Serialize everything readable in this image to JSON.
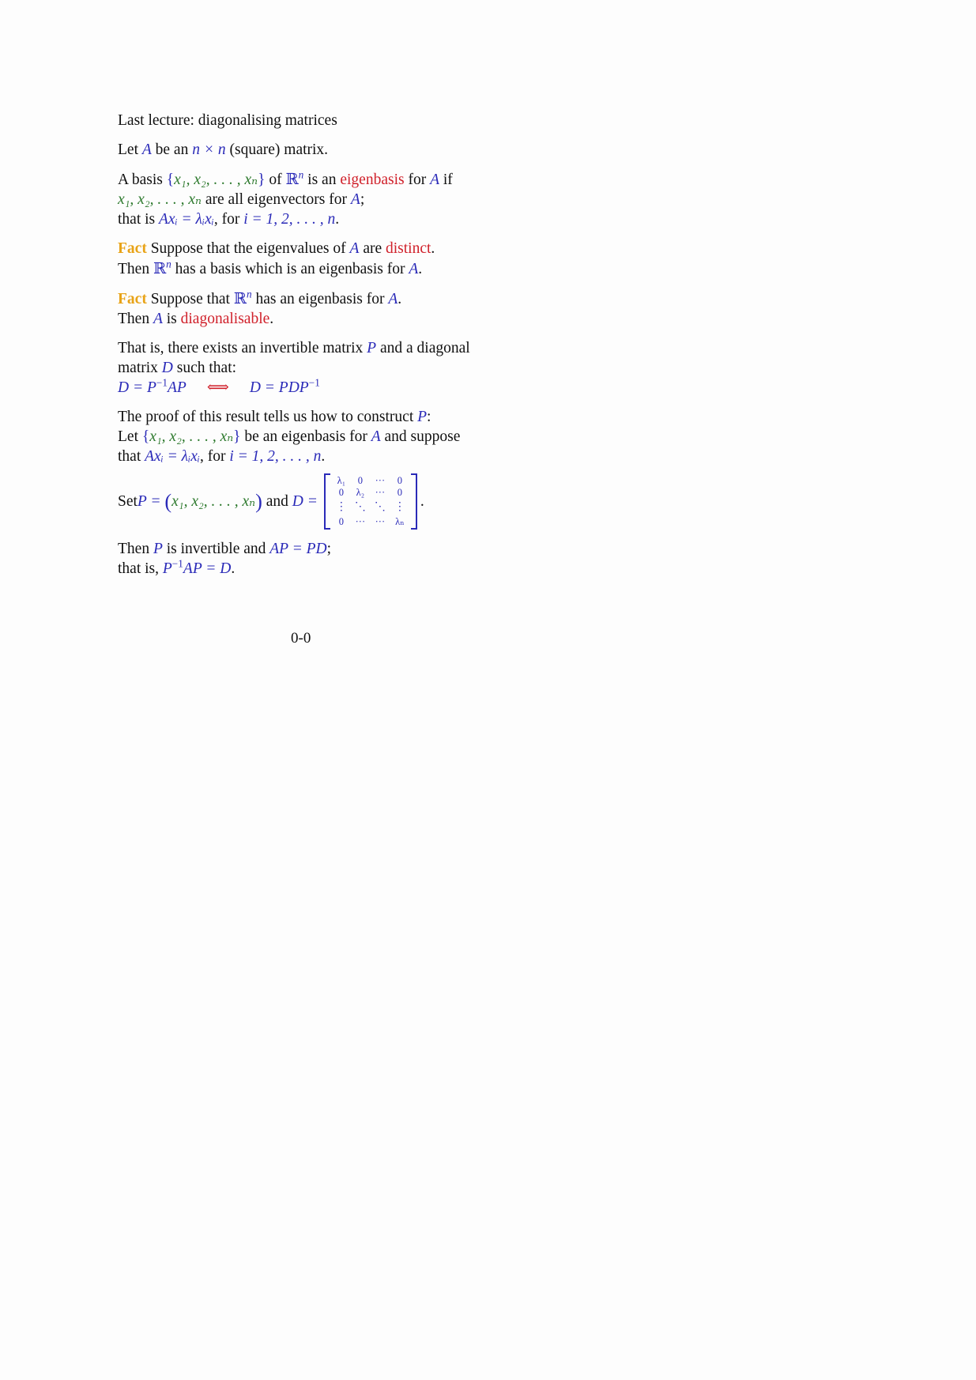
{
  "title": "Last lecture: diagonalising matrices",
  "intro": {
    "pre": "Let ",
    "A": "A",
    "mid": " be an ",
    "nxn": "n × n",
    "post": " (square) matrix."
  },
  "basis_def": {
    "line1_pre": "A basis ",
    "set": "x₁, x₂, . . . , xₙ",
    "of": " of ",
    "Rn": "ℝ",
    "n": "n",
    "is_an": " is an ",
    "eigenbasis": "eigenbasis",
    "for": " for ",
    "A": "A",
    "if": " if",
    "line2_vecs": "x₁, x₂, . . . , xₙ",
    "line2_post": " are all eigenvectors for ",
    "line2_end": ";",
    "line3_pre": "that is ",
    "line3_eq": "Axᵢ = λᵢxᵢ",
    "line3_mid": ", for ",
    "line3_range": "i = 1, 2, . . . , n",
    "line3_end": "."
  },
  "fact1": {
    "label": "Fact",
    "line1_pre": " Suppose that the eigenvalues of ",
    "A": "A",
    "line1_mid": " are ",
    "distinct": "distinct",
    "line1_end": ".",
    "line2_pre": "Then ",
    "Rn": "ℝ",
    "n": "n",
    "line2_post": " has a basis which is an eigenbasis for ",
    "line2_end": "."
  },
  "fact2": {
    "label": "Fact",
    "line1_pre": " Suppose that ",
    "Rn": "ℝ",
    "n": "n",
    "line1_post": " has an eigenbasis for ",
    "A": "A",
    "line1_end": ".",
    "line2_pre": "Then ",
    "line2_mid": " is ",
    "diagonalisable": "diagonalisable",
    "line2_end": "."
  },
  "exists": {
    "line1_pre": "That is, there exists an invertible matrix ",
    "P": "P",
    "line1_post": " and a diagonal",
    "line2_pre": "matrix ",
    "D": "D",
    "line2_post": " such that:",
    "eq_left": "D = P",
    "eq_left_sup": "−1",
    "eq_left_post": "AP",
    "iff": "⟺",
    "eq_right": "D = PDP",
    "eq_right_sup": "−1"
  },
  "proof": {
    "line1_pre": "The proof of this result tells us how to construct ",
    "P": "P",
    "line1_end": ":",
    "line2_pre": "Let ",
    "set": "x₁, x₂, . . . , xₙ",
    "line2_mid": " be an eigenbasis for ",
    "A": "A",
    "line2_post": " and suppose",
    "line3_pre": "that ",
    "line3_eq": "Axᵢ = λᵢxᵢ",
    "line3_mid": ", for ",
    "line3_range": "i = 1, 2, . . . , n",
    "line3_end": "."
  },
  "setline": {
    "pre": "Set ",
    "P_eq": "P = ",
    "vecs": "x₁, x₂, . . . , xₙ",
    "and": " and ",
    "D_eq": "D =",
    "end": ".",
    "matrix": [
      [
        "λ₁",
        "0",
        "···",
        "0"
      ],
      [
        "0",
        "λ₂",
        "···",
        "0"
      ],
      [
        "⋮",
        "⋱",
        "⋱",
        "⋮"
      ],
      [
        "0",
        "···",
        "···",
        "λₙ"
      ]
    ]
  },
  "conclusion": {
    "line1_pre": "Then ",
    "P": "P",
    "line1_mid": " is invertible and ",
    "eq1": "AP = PD",
    "line1_end": ";",
    "line2_pre": "that is, ",
    "eq2_a": "P",
    "eq2_sup": "−1",
    "eq2_b": "AP = D",
    "line2_end": "."
  },
  "page_number": "0-0"
}
